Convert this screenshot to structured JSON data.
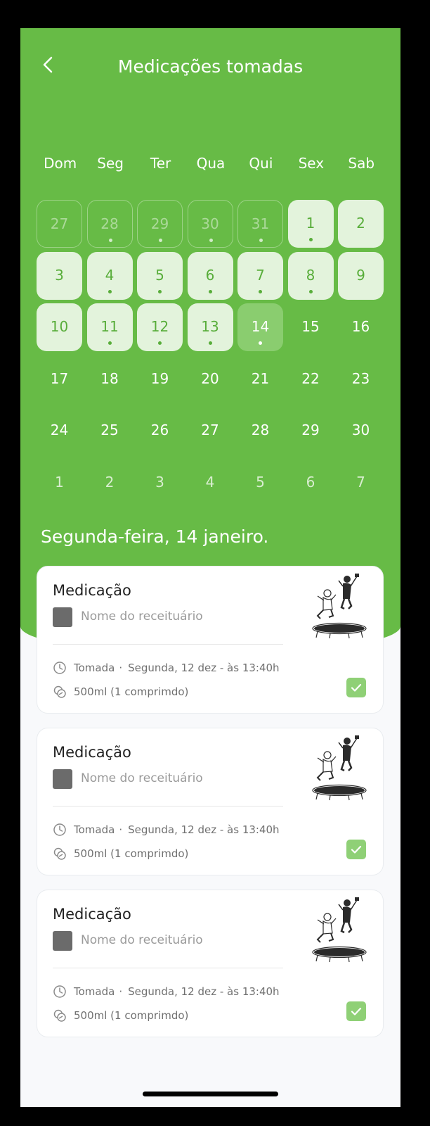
{
  "header": {
    "title": "Medicações tomadas"
  },
  "calendar": {
    "weekdays": [
      "Dom",
      "Seg",
      "Ter",
      "Qua",
      "Qui",
      "Sex",
      "Sab"
    ],
    "rows": [
      [
        {
          "day": "27",
          "state": "past",
          "dot": false
        },
        {
          "day": "28",
          "state": "past",
          "dot": true
        },
        {
          "day": "29",
          "state": "past",
          "dot": true
        },
        {
          "day": "30",
          "state": "past",
          "dot": true
        },
        {
          "day": "31",
          "state": "past",
          "dot": true
        },
        {
          "day": "1",
          "state": "taken",
          "dot": true
        },
        {
          "day": "2",
          "state": "taken",
          "dot": false
        }
      ],
      [
        {
          "day": "3",
          "state": "taken",
          "dot": false
        },
        {
          "day": "4",
          "state": "taken",
          "dot": true
        },
        {
          "day": "5",
          "state": "taken",
          "dot": true
        },
        {
          "day": "6",
          "state": "taken",
          "dot": true
        },
        {
          "day": "7",
          "state": "taken",
          "dot": true
        },
        {
          "day": "8",
          "state": "taken",
          "dot": true
        },
        {
          "day": "9",
          "state": "taken",
          "dot": false
        }
      ],
      [
        {
          "day": "10",
          "state": "taken",
          "dot": false
        },
        {
          "day": "11",
          "state": "taken",
          "dot": true
        },
        {
          "day": "12",
          "state": "taken",
          "dot": true
        },
        {
          "day": "13",
          "state": "taken",
          "dot": true
        },
        {
          "day": "14",
          "state": "today",
          "dot": true
        },
        {
          "day": "15",
          "state": "future",
          "dot": false
        },
        {
          "day": "16",
          "state": "future",
          "dot": false
        }
      ],
      [
        {
          "day": "17",
          "state": "future",
          "dot": false
        },
        {
          "day": "18",
          "state": "future",
          "dot": false
        },
        {
          "day": "19",
          "state": "future",
          "dot": false
        },
        {
          "day": "20",
          "state": "future",
          "dot": false
        },
        {
          "day": "21",
          "state": "future",
          "dot": false
        },
        {
          "day": "22",
          "state": "future",
          "dot": false
        },
        {
          "day": "23",
          "state": "future",
          "dot": false
        }
      ],
      [
        {
          "day": "24",
          "state": "future",
          "dot": false
        },
        {
          "day": "25",
          "state": "future",
          "dot": false
        },
        {
          "day": "26",
          "state": "future",
          "dot": false
        },
        {
          "day": "27",
          "state": "future",
          "dot": false
        },
        {
          "day": "28",
          "state": "future",
          "dot": false
        },
        {
          "day": "29",
          "state": "future",
          "dot": false
        },
        {
          "day": "30",
          "state": "future",
          "dot": false
        }
      ],
      [
        {
          "day": "1",
          "state": "next",
          "dot": false
        },
        {
          "day": "2",
          "state": "next",
          "dot": false
        },
        {
          "day": "3",
          "state": "next",
          "dot": false
        },
        {
          "day": "4",
          "state": "next",
          "dot": false
        },
        {
          "day": "5",
          "state": "next",
          "dot": false
        },
        {
          "day": "6",
          "state": "next",
          "dot": false
        },
        {
          "day": "7",
          "state": "next",
          "dot": false
        }
      ]
    ]
  },
  "selected_date": "Segunda-feira, 14 janeiro.",
  "cards": [
    {
      "title": "Medicação",
      "prescription": "Nome do receituário",
      "taken_label": "Tomada",
      "taken_time": "Segunda, 12 dez  - às 13:40h",
      "dosage": "500ml (1 comprimdo)",
      "checked": true
    },
    {
      "title": "Medicação",
      "prescription": "Nome do receituário",
      "taken_label": "Tomada",
      "taken_time": "Segunda, 12 dez  - às 13:40h",
      "dosage": "500ml (1 comprimdo)",
      "checked": true
    },
    {
      "title": "Medicação",
      "prescription": "Nome do receituário",
      "taken_label": "Tomada",
      "taken_time": "Segunda, 12 dez  - às 13:40h",
      "dosage": "500ml (1 comprimdo)",
      "checked": true
    }
  ],
  "icons": {
    "back": "chevron-left-icon",
    "clock": "clock-icon",
    "pills": "pills-icon",
    "check": "check-icon",
    "illustration": "trampoline-illustration"
  },
  "colors": {
    "primary_green": "#67bb46",
    "taken_cell_bg": "#e3f3dc",
    "today_cell_bg": "#8acd6f",
    "check_green": "#8fd076"
  }
}
